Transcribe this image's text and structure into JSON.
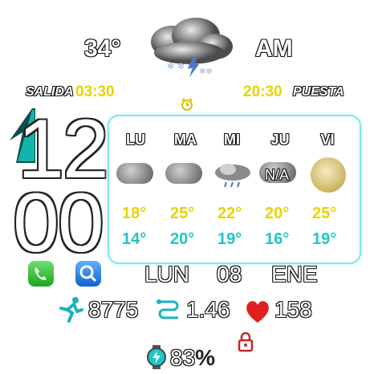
{
  "top": {
    "temperature": "34°",
    "ampm": "AM"
  },
  "sun": {
    "sunrise_label": "SALIDA",
    "sunrise_time": "03:30",
    "sunset_time": "20:30",
    "sunset_label": "PUESTA"
  },
  "time": {
    "hour": "12",
    "minute": "00"
  },
  "forecast": {
    "days": [
      "LU",
      "MA",
      "MI",
      "JU",
      "VI"
    ],
    "highs": [
      "18°",
      "25°",
      "22°",
      "20°",
      "25°"
    ],
    "lows": [
      "14°",
      "20°",
      "19°",
      "16°",
      "19°"
    ],
    "overlay_text": "N/A"
  },
  "date": {
    "weekday": "LUN",
    "day": "08",
    "month": "ENE"
  },
  "stats": {
    "steps": "8775",
    "distance": "1.46",
    "heart_rate": "158"
  },
  "battery": {
    "percent": "83",
    "unit": "%"
  },
  "colors": {
    "accent_yellow": "#e6d400",
    "accent_cyan": "#1fc6c6",
    "panel_border": "#7fe6e6",
    "heart": "#e02020",
    "lock": "#c0282a"
  },
  "icons": [
    "storm-snow-cloud-icon",
    "alarm-icon",
    "phone-icon",
    "search-icon",
    "runner-icon",
    "route-icon",
    "heart-icon",
    "lock-icon",
    "battery-watch-icon"
  ]
}
